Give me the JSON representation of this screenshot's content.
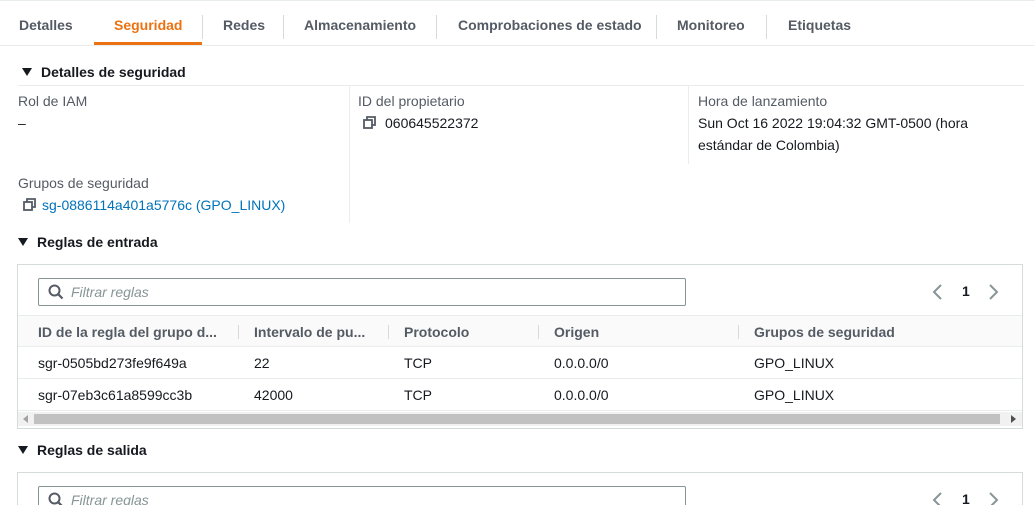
{
  "tabs": [
    {
      "label": "Detalles"
    },
    {
      "label": "Seguridad",
      "active": true
    },
    {
      "label": "Redes"
    },
    {
      "label": "Almacenamiento"
    },
    {
      "label": "Comprobaciones de estado"
    },
    {
      "label": "Monitoreo"
    },
    {
      "label": "Etiquetas"
    }
  ],
  "security_details": {
    "section_title": "Detalles de seguridad",
    "iam_role_label": "Rol de IAM",
    "iam_role_value": "–",
    "owner_id_label": "ID del propietario",
    "owner_id_value": "060645522372",
    "launch_time_label": "Hora de lanzamiento",
    "launch_time_value": "Sun Oct 16 2022 19:04:32 GMT-0500 (hora estándar de Colombia)",
    "security_groups_label": "Grupos de seguridad",
    "security_groups_value": "sg-0886114a401a5776c (GPO_LINUX)"
  },
  "inbound_rules": {
    "section_title": "Reglas de entrada",
    "filter_placeholder": "Filtrar reglas",
    "page": "1",
    "columns": [
      "ID de la regla del grupo d...",
      "Intervalo de pu...",
      "Protocolo",
      "Origen",
      "Grupos de seguridad"
    ],
    "rows": [
      [
        "sgr-0505bd273fe9f649a",
        "22",
        "TCP",
        "0.0.0.0/0",
        "GPO_LINUX"
      ],
      [
        "sgr-07eb3c61a8599cc3b",
        "42000",
        "TCP",
        "0.0.0.0/0",
        "GPO_LINUX"
      ]
    ]
  },
  "outbound_rules": {
    "section_title": "Reglas de salida",
    "filter_placeholder": "Filtrar reglas",
    "page": "1"
  },
  "colors": {
    "accent": "#ec7211",
    "link": "#0073bb",
    "text": "#16191f",
    "muted": "#545b64",
    "border": "#d5dbdb"
  },
  "icons": {
    "copy": "copy-icon",
    "search": "search-icon",
    "caret": "caret-down-icon",
    "prev": "chevron-left-icon",
    "next": "chevron-right-icon"
  }
}
